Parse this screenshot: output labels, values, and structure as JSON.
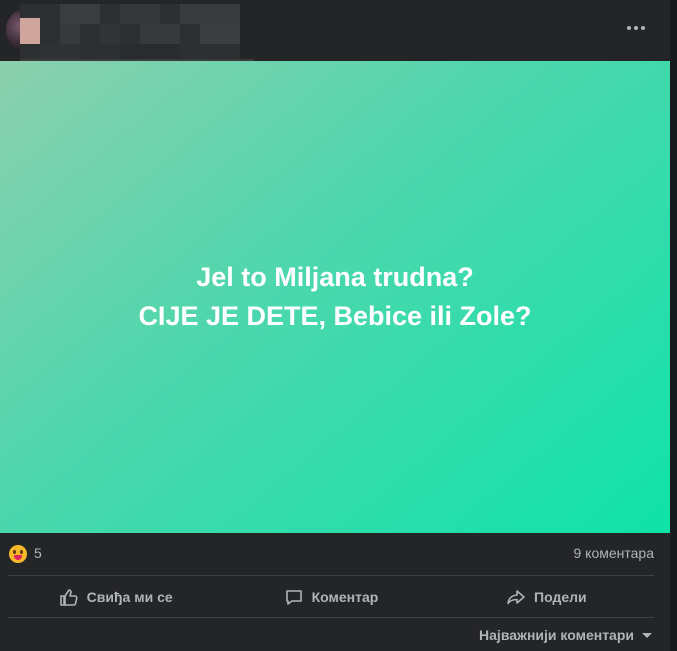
{
  "post": {
    "text_lines": [
      "Jel to Miljana trudna?",
      "CIJE JE DETE, Bebice ili Zole?"
    ],
    "background_colors": [
      "#8ccfae",
      "#0fe3a8"
    ],
    "more_icon": "ellipsis-horizontal-icon"
  },
  "stats": {
    "reaction_icon": "haha-reaction-icon",
    "reaction_count": "5",
    "comment_count": "9 коментара"
  },
  "actions": {
    "like_label": "Свиђа ми се",
    "comment_label": "Коментар",
    "share_label": "Подели"
  },
  "comments": {
    "sort_label": "Најважнији коментари"
  }
}
